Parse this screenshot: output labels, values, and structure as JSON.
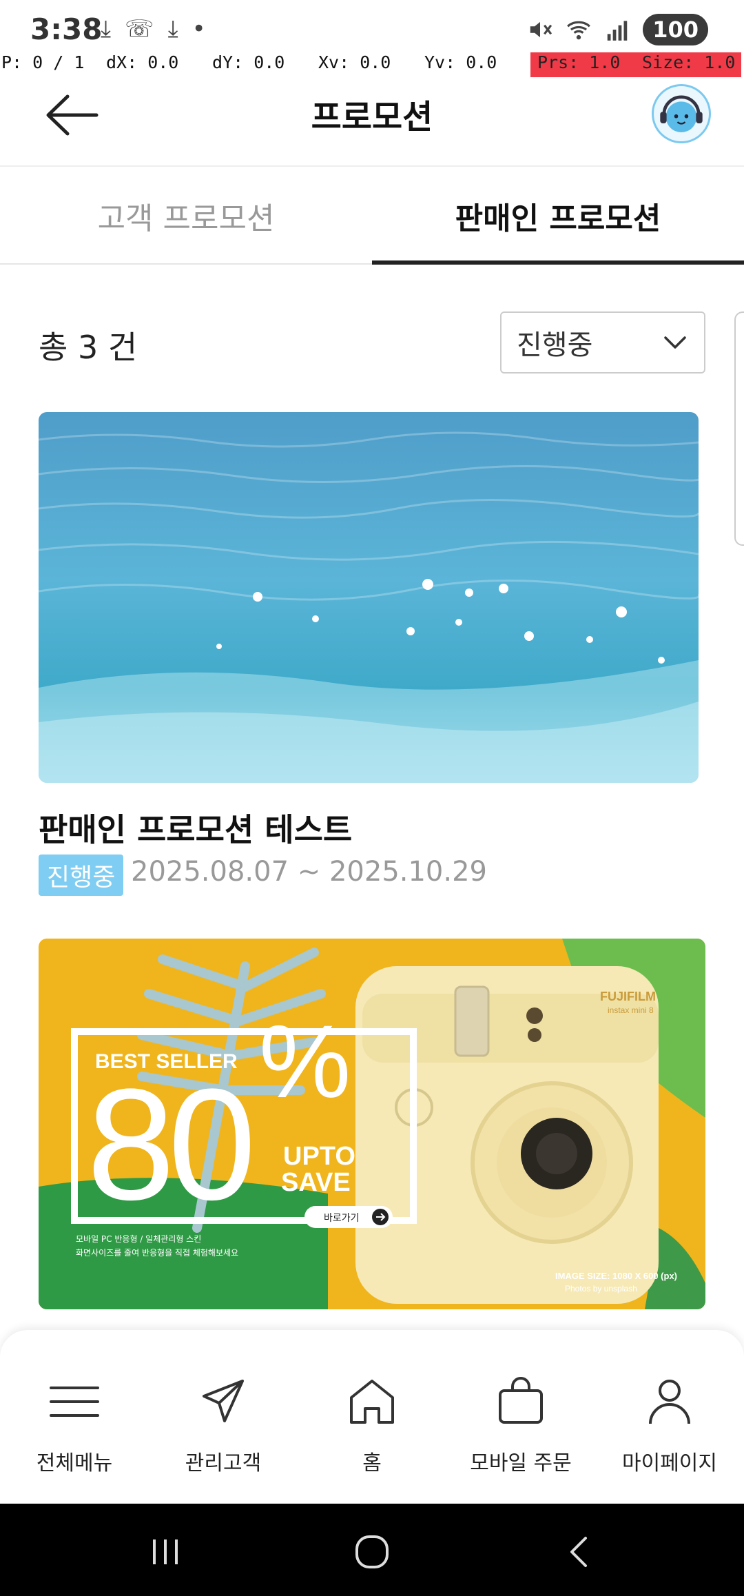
{
  "status_bar": {
    "time": "3:38",
    "battery": "100"
  },
  "debug": {
    "pointer": "P: 0 / 1",
    "dx": "dX: 0.0",
    "dy": "dY: 0.0",
    "xv": "Xv: 0.0",
    "yv": "Yv: 0.0",
    "prs": "Prs: 1.0",
    "size": "Size: 1.0"
  },
  "header": {
    "title": "프로모션"
  },
  "tabs": [
    {
      "label": "고객 프로모션",
      "active": false
    },
    {
      "label": "판매인 프로모션",
      "active": true
    }
  ],
  "filter": {
    "total": "총 3 건",
    "selected": "진행중"
  },
  "promotions": [
    {
      "title": "판매인 프로모션 테스트",
      "status": "진행중",
      "period": "2025.08.07 ~ 2025.10.29"
    }
  ],
  "banner2": {
    "best_seller": "BEST SELLER",
    "number": "80",
    "percent": "%",
    "upto": "UPTO",
    "save": "SAVE",
    "button": "바로가기",
    "desc_line1": "모바일 PC 반응형 / 일체관리형 스킨",
    "desc_line2": "화면사이즈를 줄여 반응형을 직접 체험해보세요",
    "brand": "FUJIFILM",
    "model": "instax mini 8",
    "image_size": "IMAGE SIZE: 1080 X 600 (px)",
    "photos_by": "Photos by unsplash"
  },
  "bottom_nav": [
    {
      "label": "전체메뉴",
      "icon": "menu-icon"
    },
    {
      "label": "관리고객",
      "icon": "send-icon"
    },
    {
      "label": "홈",
      "icon": "home-icon"
    },
    {
      "label": "모바일 주문",
      "icon": "bag-icon"
    },
    {
      "label": "마이페이지",
      "icon": "person-icon"
    }
  ],
  "colors": {
    "accent": "#7fcdf2",
    "active_tab": "#222222",
    "debug_red": "#f03a47"
  }
}
